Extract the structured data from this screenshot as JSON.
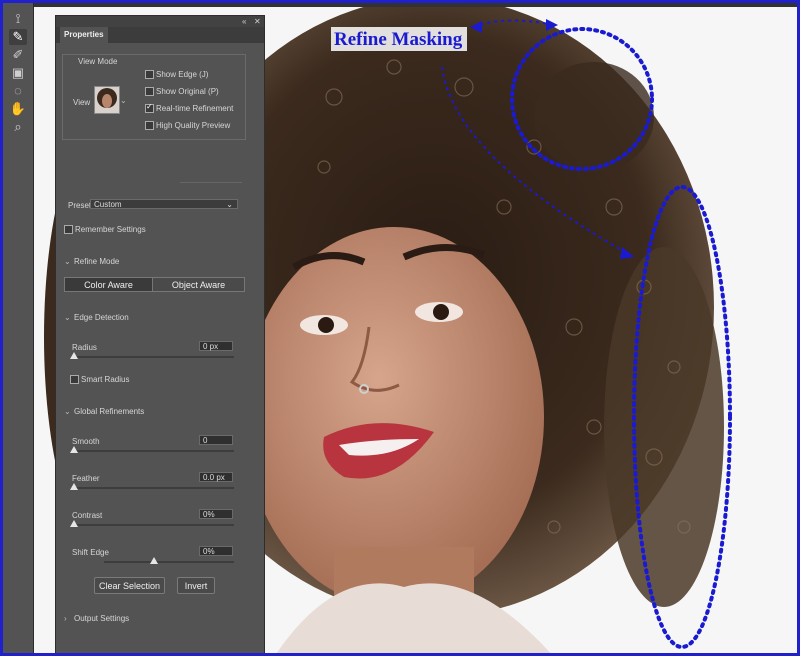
{
  "annotation": {
    "title": "Refine Masking",
    "color": "#1a1ad0"
  },
  "toolbar": {
    "tools": [
      "quick-selection-icon",
      "refine-edge-brush-icon",
      "brush-icon",
      "object-selection-icon",
      "lasso-icon",
      "hand-icon",
      "zoom-icon"
    ]
  },
  "panel": {
    "tab_label": "Properties",
    "view_mode": {
      "heading": "View Mode",
      "view_label": "View",
      "show_edge": "Show Edge (J)",
      "show_original": "Show Original (P)",
      "realtime": "Real-time Refinement",
      "hq_preview": "High Quality Preview"
    },
    "preset": {
      "label": "Preset",
      "value": "Custom"
    },
    "remember": "Remember Settings",
    "refine_mode": {
      "heading": "Refine Mode",
      "color_aware": "Color Aware",
      "object_aware": "Object Aware"
    },
    "edge_detection": {
      "heading": "Edge Detection",
      "radius_label": "Radius",
      "radius_value": "0 px",
      "smart_radius": "Smart Radius"
    },
    "global": {
      "heading": "Global Refinements",
      "smooth_label": "Smooth",
      "smooth_value": "0",
      "feather_label": "Feather",
      "feather_value": "0.0 px",
      "contrast_label": "Contrast",
      "contrast_value": "0%",
      "shift_label": "Shift Edge",
      "shift_value": "0%"
    },
    "clear_selection": "Clear Selection",
    "invert": "Invert",
    "output": "Output Settings"
  }
}
